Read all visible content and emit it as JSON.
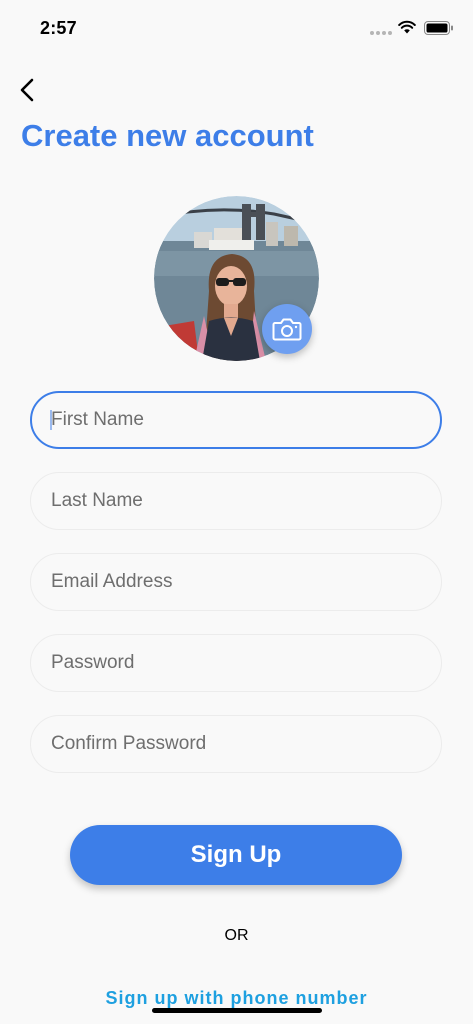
{
  "status_bar": {
    "time": "2:57"
  },
  "header": {
    "title": "Create new account"
  },
  "form": {
    "first_name": {
      "placeholder": "First Name",
      "value": ""
    },
    "last_name": {
      "placeholder": "Last Name",
      "value": ""
    },
    "email": {
      "placeholder": "Email Address",
      "value": ""
    },
    "password": {
      "placeholder": "Password",
      "value": ""
    },
    "confirm_password": {
      "placeholder": "Confirm Password",
      "value": ""
    }
  },
  "actions": {
    "signup_label": "Sign Up",
    "or_label": "OR",
    "phone_signup_label": "Sign up with phone number"
  },
  "icons": {
    "back": "chevron-left-icon",
    "camera": "camera-icon",
    "wifi": "wifi-icon",
    "battery": "battery-icon"
  },
  "colors": {
    "accent": "#3d7ee8",
    "link": "#1ea0e0",
    "camera_button": "#6f9ff0",
    "background": "#f9f9f9"
  }
}
